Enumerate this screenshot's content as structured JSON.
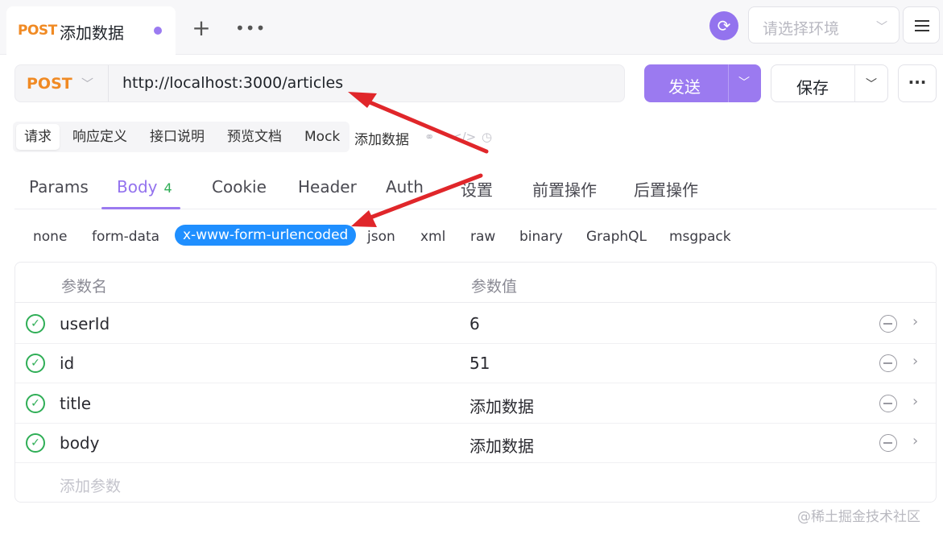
{
  "tabbar": {
    "tab_method": "POST",
    "tab_title": "添加数据",
    "new_tab": "+",
    "more_tabs": "•••",
    "env_placeholder": "请选择环境"
  },
  "request": {
    "method": "POST",
    "url": "http://localhost:3000/articles",
    "send_label": "发送",
    "save_label": "保存"
  },
  "doc_tabs": [
    "请求",
    "响应定义",
    "接口说明",
    "预览文档",
    "Mock"
  ],
  "doc_name": "添加数据",
  "main_tabs": {
    "params": "Params",
    "body": "Body",
    "body_count": "4",
    "cookie": "Cookie",
    "header": "Header",
    "auth": "Auth",
    "settings": "设置",
    "pre_ops": "前置操作",
    "post_ops": "后置操作"
  },
  "body_types": {
    "none": "none",
    "form_data": "form-data",
    "urlencoded": "x-www-form-urlencoded",
    "json": "json",
    "xml": "xml",
    "raw": "raw",
    "binary": "binary",
    "graphql": "GraphQL",
    "msgpack": "msgpack",
    "selected": "x-www-form-urlencoded"
  },
  "params_table": {
    "col_name": "参数名",
    "col_value": "参数值",
    "rows": [
      {
        "name": "userId",
        "value": "6",
        "enabled": true
      },
      {
        "name": "id",
        "value": "51",
        "enabled": true
      },
      {
        "name": "title",
        "value": "添加数据",
        "enabled": true
      },
      {
        "name": "body",
        "value": "添加数据",
        "enabled": true
      }
    ],
    "add_placeholder": "添加参数"
  },
  "colors": {
    "accent": "#9b7af0",
    "post_method": "#f08a24",
    "selected_pill": "#1f8fff",
    "check_green": "#2fae56",
    "annotation_arrow": "#e0262a"
  },
  "icons": [
    "sync-icon",
    "chevron-down-icon",
    "menu-icon",
    "more-icon",
    "link-icon",
    "code-icon",
    "clock-icon",
    "check-circle-icon",
    "remove-icon",
    "chevron-right-icon"
  ],
  "watermark": "@稀土掘金技术社区"
}
